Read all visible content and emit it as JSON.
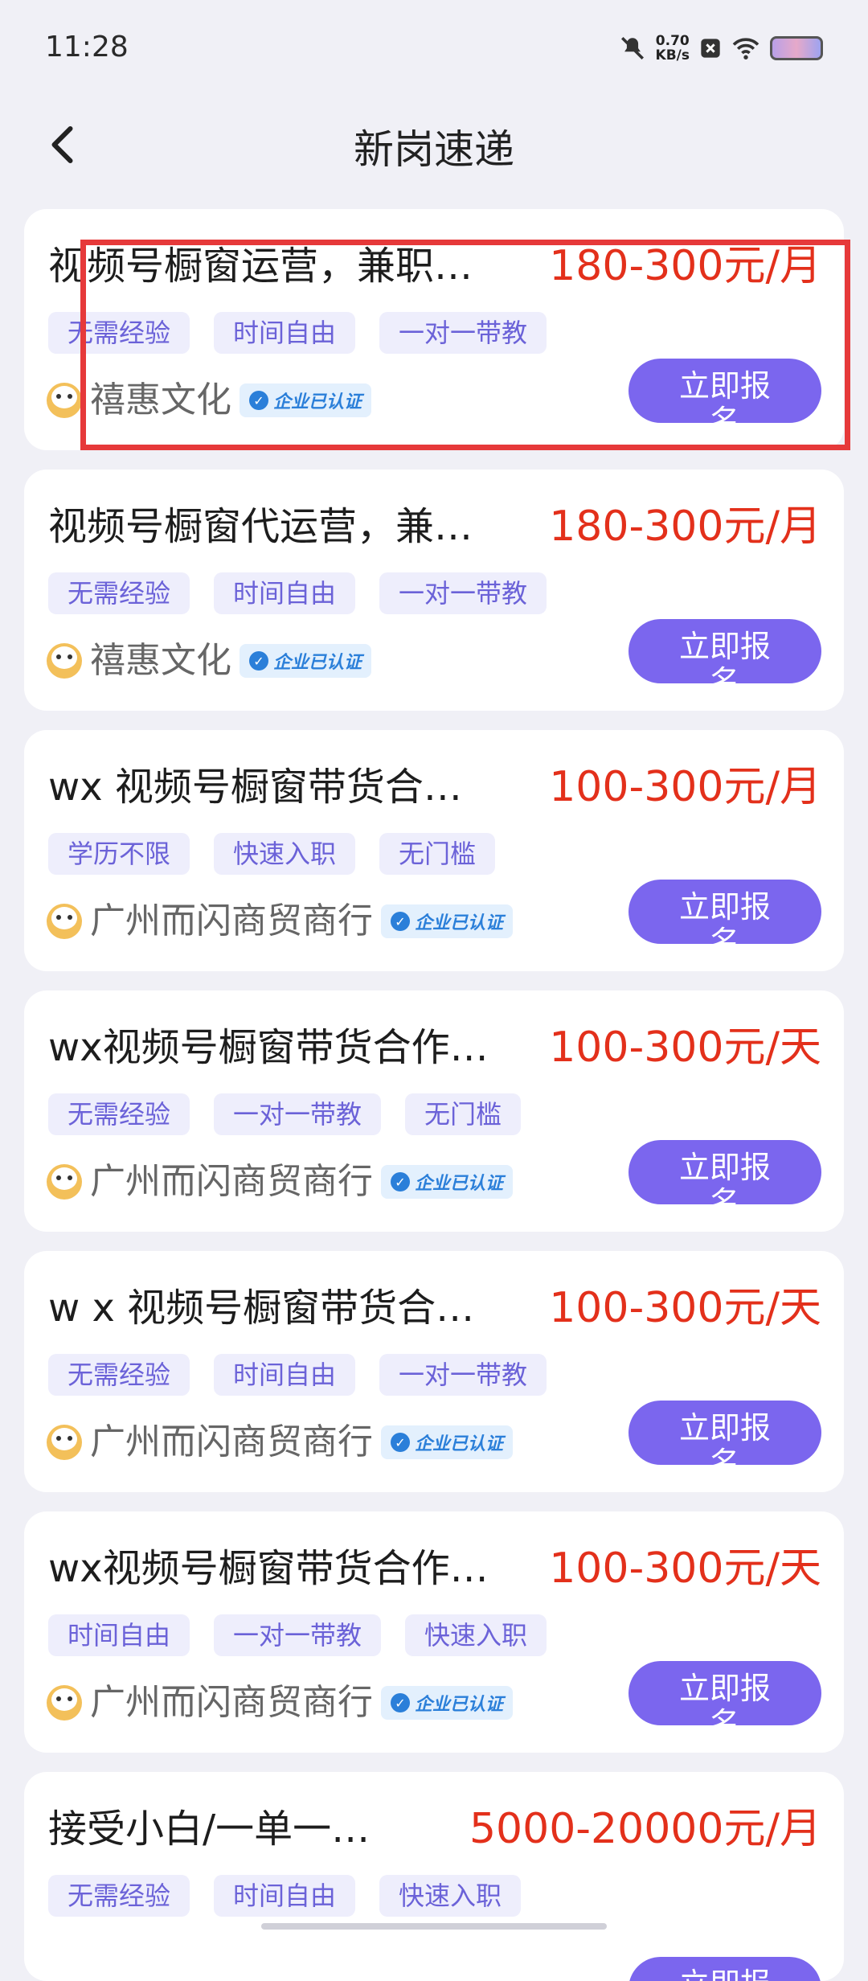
{
  "status_bar": {
    "time": "11:28",
    "net_speed_value": "0.70",
    "net_speed_unit": "KB/s",
    "icons": [
      "mute-icon",
      "speed-indicator",
      "notification-x-icon",
      "wifi-icon",
      "battery-icon"
    ]
  },
  "nav": {
    "title": "新岗速递",
    "back_icon": "chevron-left-icon"
  },
  "jobs": [
    {
      "title": "视频号橱窗运营，兼职…",
      "salary": "180-300元/月",
      "tags": [
        "无需经验",
        "时间自由",
        "一对一带教"
      ],
      "company": "禧惠文化",
      "verified": "企业已认证",
      "apply": "立即报名"
    },
    {
      "title": "视频号橱窗代运营，兼…",
      "salary": "180-300元/月",
      "tags": [
        "无需经验",
        "时间自由",
        "一对一带教"
      ],
      "company": "禧惠文化",
      "verified": "企业已认证",
      "apply": "立即报名"
    },
    {
      "title": "wx 视频号橱窗带货合…",
      "salary": "100-300元/月",
      "tags": [
        "学历不限",
        "快速入职",
        "无门槛"
      ],
      "company": "广州而闪商贸商行",
      "verified": "企业已认证",
      "apply": "立即报名"
    },
    {
      "title": "wx视频号橱窗带货合作…",
      "salary": "100-300元/天",
      "tags": [
        "无需经验",
        "一对一带教",
        "无门槛"
      ],
      "company": "广州而闪商贸商行",
      "verified": "企业已认证",
      "apply": "立即报名"
    },
    {
      "title": "w x 视频号橱窗带货合…",
      "salary": "100-300元/天",
      "tags": [
        "无需经验",
        "时间自由",
        "一对一带教"
      ],
      "company": "广州而闪商贸商行",
      "verified": "企业已认证",
      "apply": "立即报名"
    },
    {
      "title": "wx视频号橱窗带货合作…",
      "salary": "100-300元/天",
      "tags": [
        "时间自由",
        "一对一带教",
        "快速入职"
      ],
      "company": "广州而闪商贸商行",
      "verified": "企业已认证",
      "apply": "立即报名"
    },
    {
      "title": "接受小白/一单一…",
      "salary": "5000-20000元/月",
      "tags": [
        "无需经验",
        "时间自由",
        "快速入职"
      ],
      "company": "",
      "verified": "",
      "apply": "立即报名"
    }
  ],
  "colors": {
    "accent": "#7b66ee",
    "salary": "#e3301b",
    "tag_text": "#6b62d8",
    "tag_bg": "#eeeefc",
    "verified": "#2b7fd9",
    "highlight": "#e6393a"
  }
}
